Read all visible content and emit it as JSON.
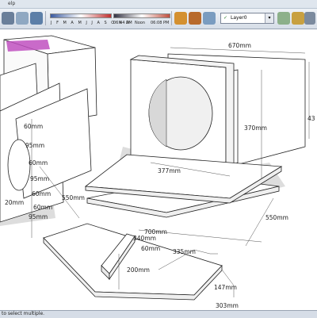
{
  "menubar": {
    "partial": "elp"
  },
  "toolbar": {
    "months": "J F M A M J J A S O N D",
    "time_start": "06:44 AM",
    "time_noon": "Noon",
    "time_end": "06:08 PM",
    "layer": "Layer0",
    "layer_check": "✓"
  },
  "dimensions": {
    "top_width": "670mm",
    "right_height": "43",
    "mid_height": "370mm",
    "circle_width": "377mm",
    "left_depth": "550mm",
    "base_depth": "550mm",
    "base_width": "700mm",
    "front_width": "335mm",
    "slat_width": "340mm",
    "slat_depth": "60mm",
    "slat_length": "200mm",
    "tip_a": "147mm",
    "tip_b": "303mm",
    "s1": "60mm",
    "s2": "95mm",
    "s3": "60mm",
    "s4": "95mm",
    "s5": "60mm",
    "s6": "60mm",
    "s7": "95mm",
    "s8": "20mm"
  },
  "status": {
    "text": "to select multiple."
  }
}
